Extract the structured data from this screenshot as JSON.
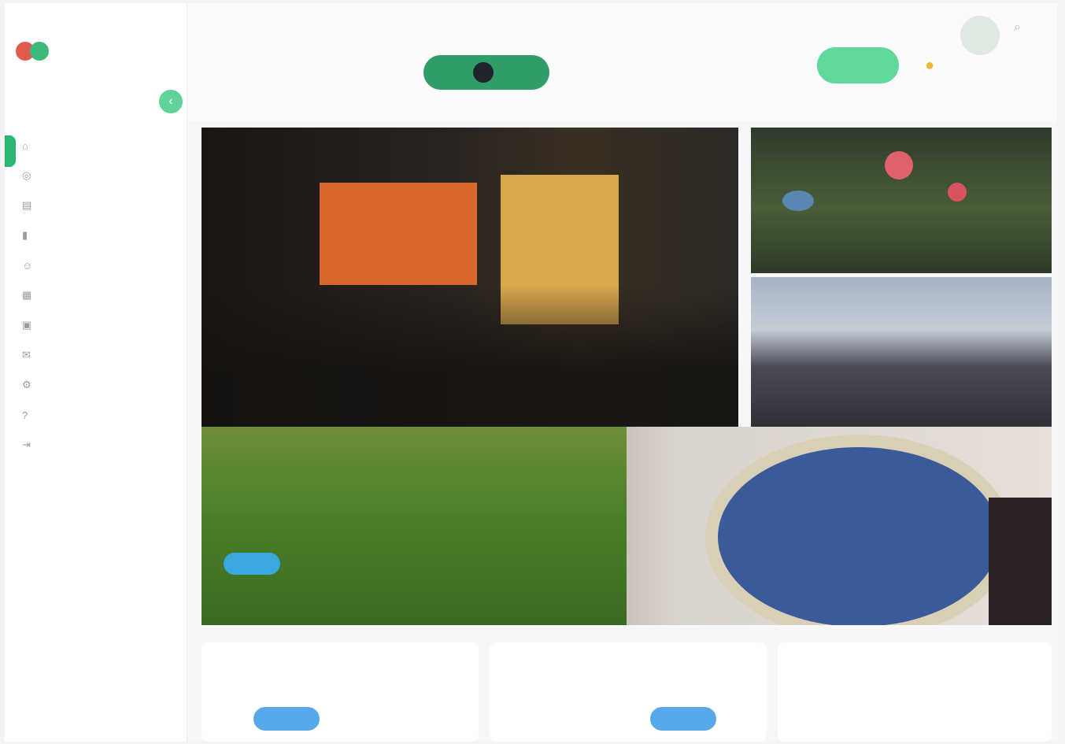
{
  "sidebar": {
    "logo": "",
    "nav_items": [
      {
        "label": "",
        "icon": "home-icon"
      },
      {
        "label": "",
        "icon": "compass-icon"
      },
      {
        "label": "",
        "icon": "chart-icon"
      },
      {
        "label": "",
        "icon": "bookmark-icon"
      },
      {
        "label": "",
        "icon": "users-icon"
      },
      {
        "label": "",
        "icon": "calendar-icon"
      },
      {
        "label": "",
        "icon": "image-icon"
      },
      {
        "label": "",
        "icon": "mail-icon"
      },
      {
        "label": "",
        "icon": "gear-icon"
      },
      {
        "label": "",
        "icon": "help-icon"
      },
      {
        "label": "",
        "icon": "logout-icon"
      }
    ],
    "footer_lines": [
      "",
      ""
    ]
  },
  "topbar": {
    "links": [
      "",
      ""
    ],
    "active_tab": "",
    "cta_label": ""
  },
  "hero": {
    "feature_title": "",
    "grass_tag": "",
    "grass_caption": ""
  },
  "cards": [
    {
      "meta": "",
      "title": "",
      "tag": ""
    },
    {
      "meta": "",
      "title": "",
      "tag": ""
    },
    {
      "meta": "",
      "title": "",
      "tag": ""
    }
  ],
  "colors": {
    "accent_green": "#2bb673",
    "cta_green": "#5fd89b",
    "tag_blue": "#56a8ea"
  }
}
